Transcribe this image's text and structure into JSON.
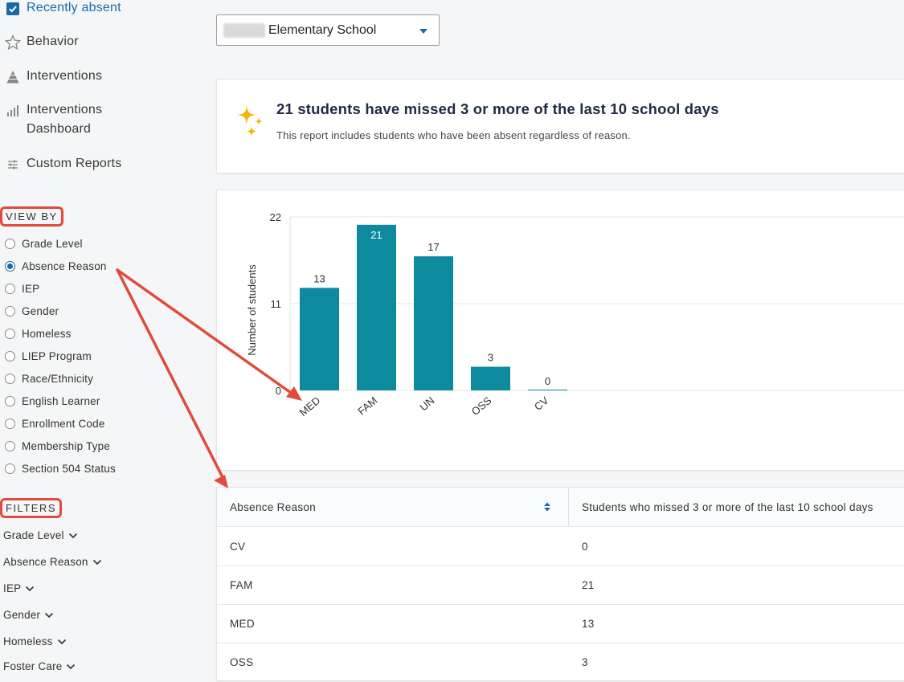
{
  "sidebar": {
    "nav": [
      {
        "label": "Recently absent",
        "icon": "checkbox-checked-icon",
        "active": true
      },
      {
        "label": "Behavior",
        "icon": "star-icon"
      },
      {
        "label": "Interventions",
        "icon": "pyramid-icon"
      },
      {
        "label": "Interventions Dashboard",
        "line1": "Interventions",
        "line2": "Dashboard",
        "icon": "bar-chart-icon"
      },
      {
        "label": "Custom Reports",
        "icon": "sliders-icon"
      }
    ],
    "view_by": {
      "title": "VIEW BY",
      "options": [
        "Grade Level",
        "Absence Reason",
        "IEP",
        "Gender",
        "Homeless",
        "LIEP Program",
        "Race/Ethnicity",
        "English Learner",
        "Enrollment Code",
        "Membership Type",
        "Section 504 Status"
      ],
      "selected": "Absence Reason"
    },
    "filters": {
      "title": "FILTERS",
      "items": [
        "Grade Level",
        "Absence Reason",
        "IEP",
        "Gender",
        "Homeless",
        "Foster Care"
      ]
    }
  },
  "school_select": {
    "value": "Elementary School"
  },
  "summary": {
    "headline": "21 students have missed 3 or more of the last 10 school days",
    "subtext": "This report includes students who have been absent regardless of reason."
  },
  "chart_data": {
    "type": "bar",
    "categories": [
      "MED",
      "FAM",
      "UN",
      "OSS",
      "CV"
    ],
    "values": [
      13,
      21,
      17,
      3,
      0
    ],
    "ylabel": "Number of students",
    "yticks": [
      0,
      11,
      22
    ],
    "ylim": [
      0,
      22
    ],
    "color": "#0d8a9e",
    "grid": true
  },
  "table": {
    "headers": [
      "Absence Reason",
      "Students who missed 3 or more of the last 10 school days"
    ],
    "rows": [
      [
        "CV",
        "0"
      ],
      [
        "FAM",
        "21"
      ],
      [
        "MED",
        "13"
      ],
      [
        "OSS",
        "3"
      ]
    ]
  },
  "colors": {
    "accent": "#1a6aa8",
    "bar": "#0d8a9e",
    "annotation": "#e24a3b",
    "sparkle": "#f2b705"
  }
}
